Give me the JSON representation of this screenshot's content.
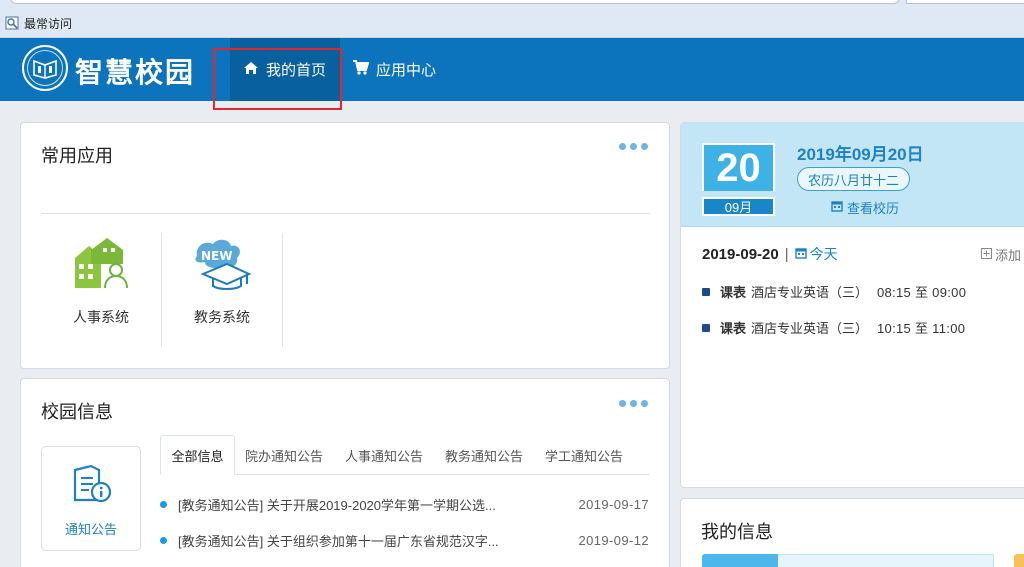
{
  "browser": {
    "bookmark_label": "最常访问"
  },
  "header": {
    "site_name": "智慧校园",
    "nav": [
      {
        "label": "我的首页",
        "icon": "home-icon",
        "active": true
      },
      {
        "label": "应用中心",
        "icon": "cart-icon",
        "active": false
      }
    ]
  },
  "common_apps": {
    "title": "常用应用",
    "items": [
      {
        "label": "人事系统",
        "icon": "personnel-system-icon"
      },
      {
        "label": "教务系统",
        "icon": "academic-system-icon",
        "badge": "NEW"
      }
    ]
  },
  "campus_info": {
    "title": "校园信息",
    "side_label": "通知公告",
    "tabs": [
      "全部信息",
      "院办通知公告",
      "人事通知公告",
      "教务通知公告",
      "学工通知公告"
    ],
    "active_tab": 0,
    "news": [
      {
        "title": "[教务通知公告] 关于开展2019-2020学年第一学期公选...",
        "date": "2019-09-17"
      },
      {
        "title": "[教务通知公告] 关于组织参加第十一届广东省规范汉字...",
        "date": "2019-09-12"
      }
    ]
  },
  "calendar": {
    "day": "20",
    "month": "09月",
    "full_date": "2019年09月20日",
    "lunar": "农历八月廿十二",
    "view_label": "查看校历",
    "schedule_date": "2019-09-20",
    "today_label": "今天",
    "add_label": "添加",
    "events": [
      {
        "type": "课表",
        "name": "酒店专业英语（三）",
        "time": "08:15 至 09:00"
      },
      {
        "type": "课表",
        "name": "酒店专业英语（三）",
        "time": "10:15 至 11:00"
      }
    ]
  },
  "my_info": {
    "title": "我的信息"
  },
  "colors": {
    "navbar": "#0b74bd",
    "nav_active": "#08609e",
    "highlight_box": "#e2262b",
    "accent": "#1d81c3",
    "calendar_bg": "#c3e6f6"
  }
}
